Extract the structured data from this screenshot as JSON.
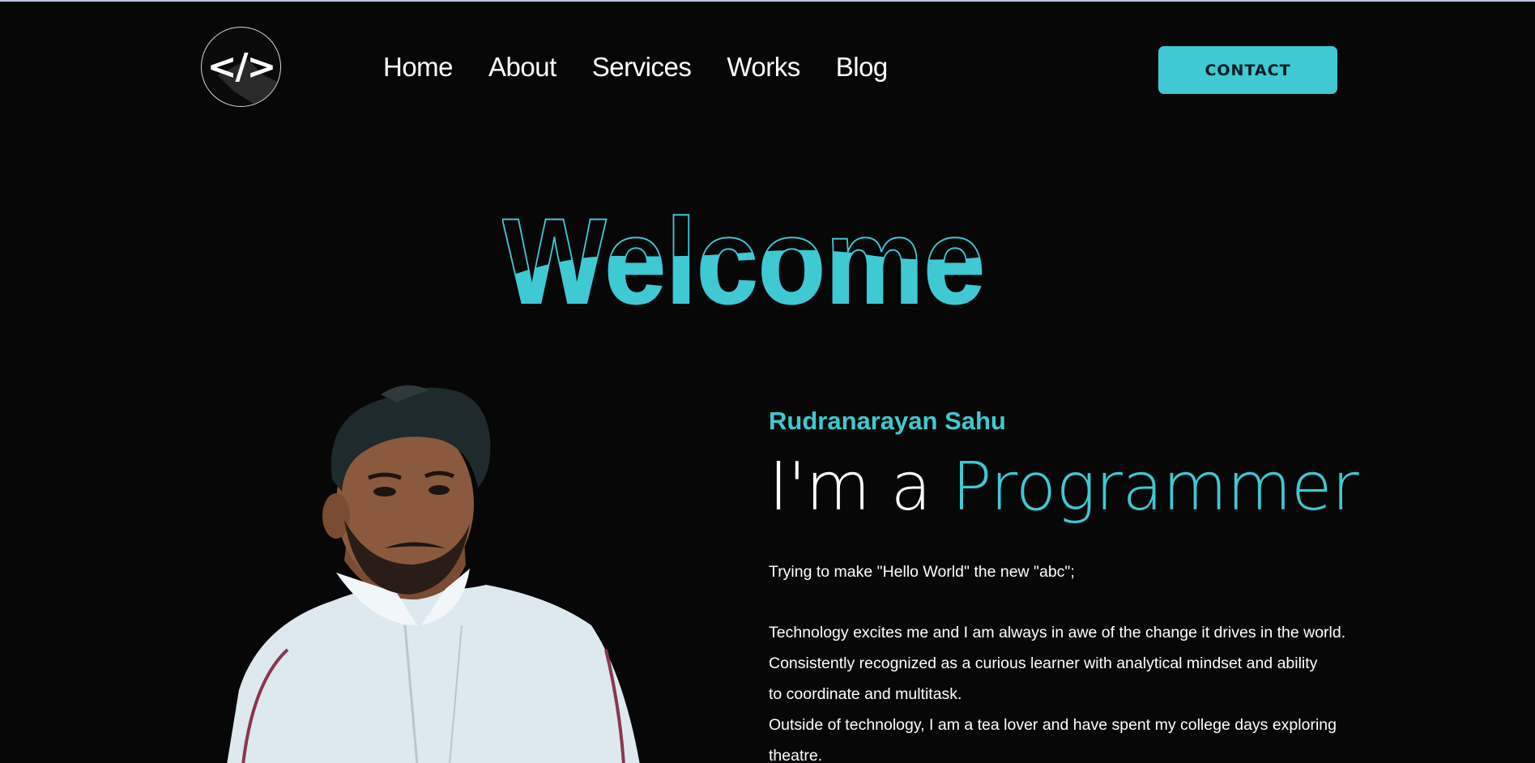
{
  "header": {
    "logo_text": "</>",
    "nav": [
      "Home",
      "About",
      "Services",
      "Works",
      "Blog"
    ],
    "contact_label": "CONTACT"
  },
  "hero": {
    "title": "Welcome"
  },
  "bio": {
    "name": "Rudranarayan Sahu",
    "headline_prefix": "I'm a",
    "role": "Programmer",
    "tagline": "Trying to make \"Hello World\" the new \"abc\";",
    "lines": [
      "Technology excites me and I am always in awe of the change it drives in the world.",
      "Consistently recognized as a curious learner with analytical mindset and ability",
      "to coordinate and multitask.",
      "Outside of technology, I am a tea lover and have spent my college days exploring",
      "theatre."
    ]
  },
  "colors": {
    "accent": "#3ec9d3",
    "background": "#070707",
    "text": "#ffffff"
  }
}
